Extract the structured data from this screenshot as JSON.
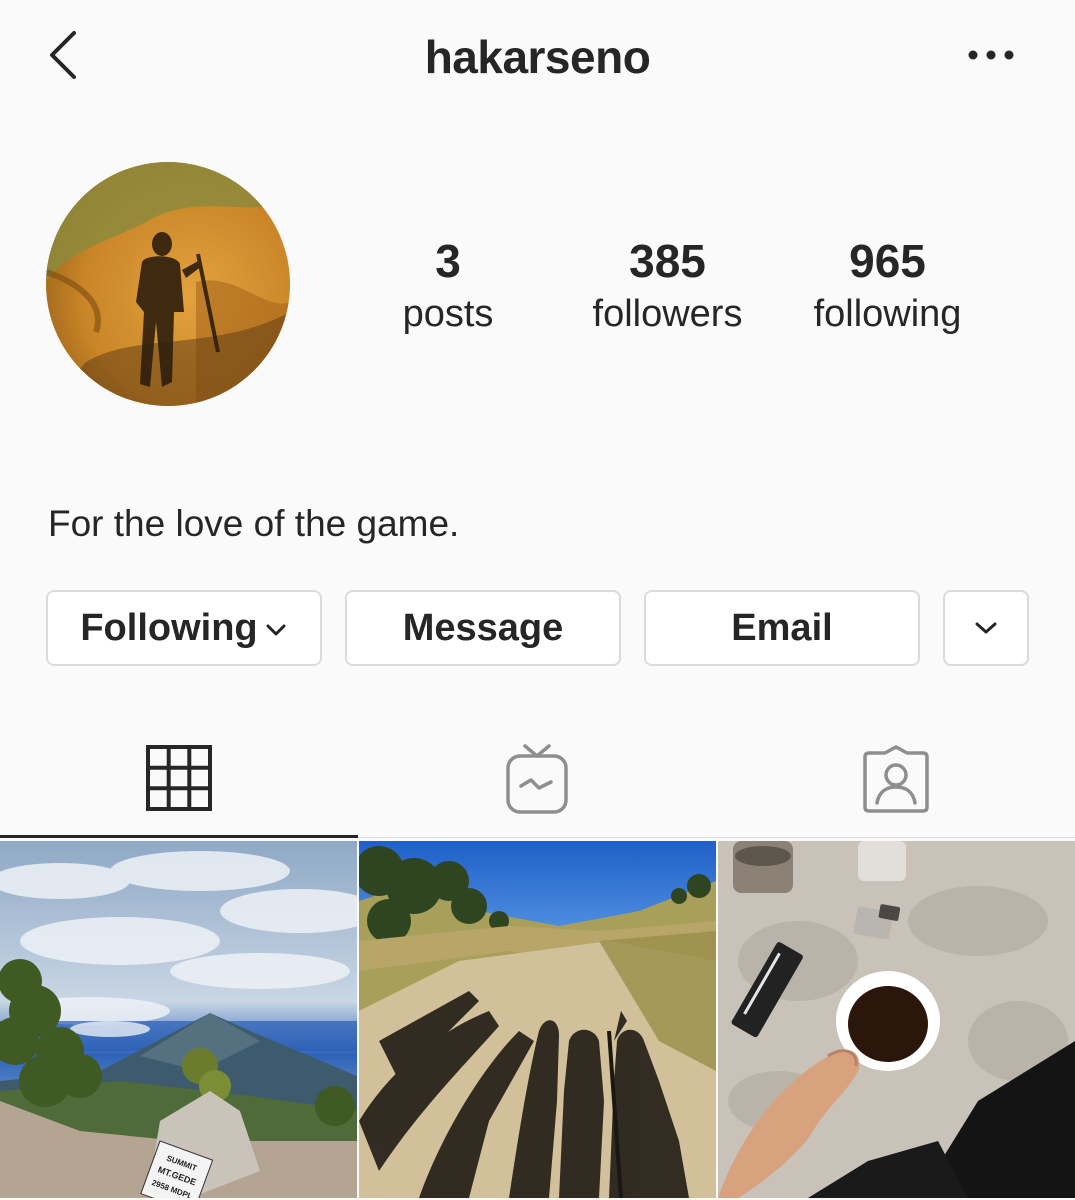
{
  "header": {
    "username": "hakarseno"
  },
  "stats": {
    "posts": {
      "count": "3",
      "label": "posts"
    },
    "followers": {
      "count": "385",
      "label": "followers"
    },
    "following": {
      "count": "965",
      "label": "following"
    }
  },
  "bio": "For the love of the game.",
  "actions": {
    "following_label": "Following",
    "message_label": "Message",
    "email_label": "Email"
  },
  "tabs": {
    "active": "grid"
  },
  "posts": [
    {
      "sign_lines": [
        "SUMMIT",
        "MT.GEDE",
        "2958 MDPL"
      ]
    },
    {
      "sign_lines": []
    },
    {
      "sign_lines": []
    }
  ],
  "icons": [
    "back-arrow-icon",
    "more-horizontal-icon",
    "chevron-down-icon",
    "grid-icon",
    "igtv-icon",
    "tagged-icon"
  ]
}
